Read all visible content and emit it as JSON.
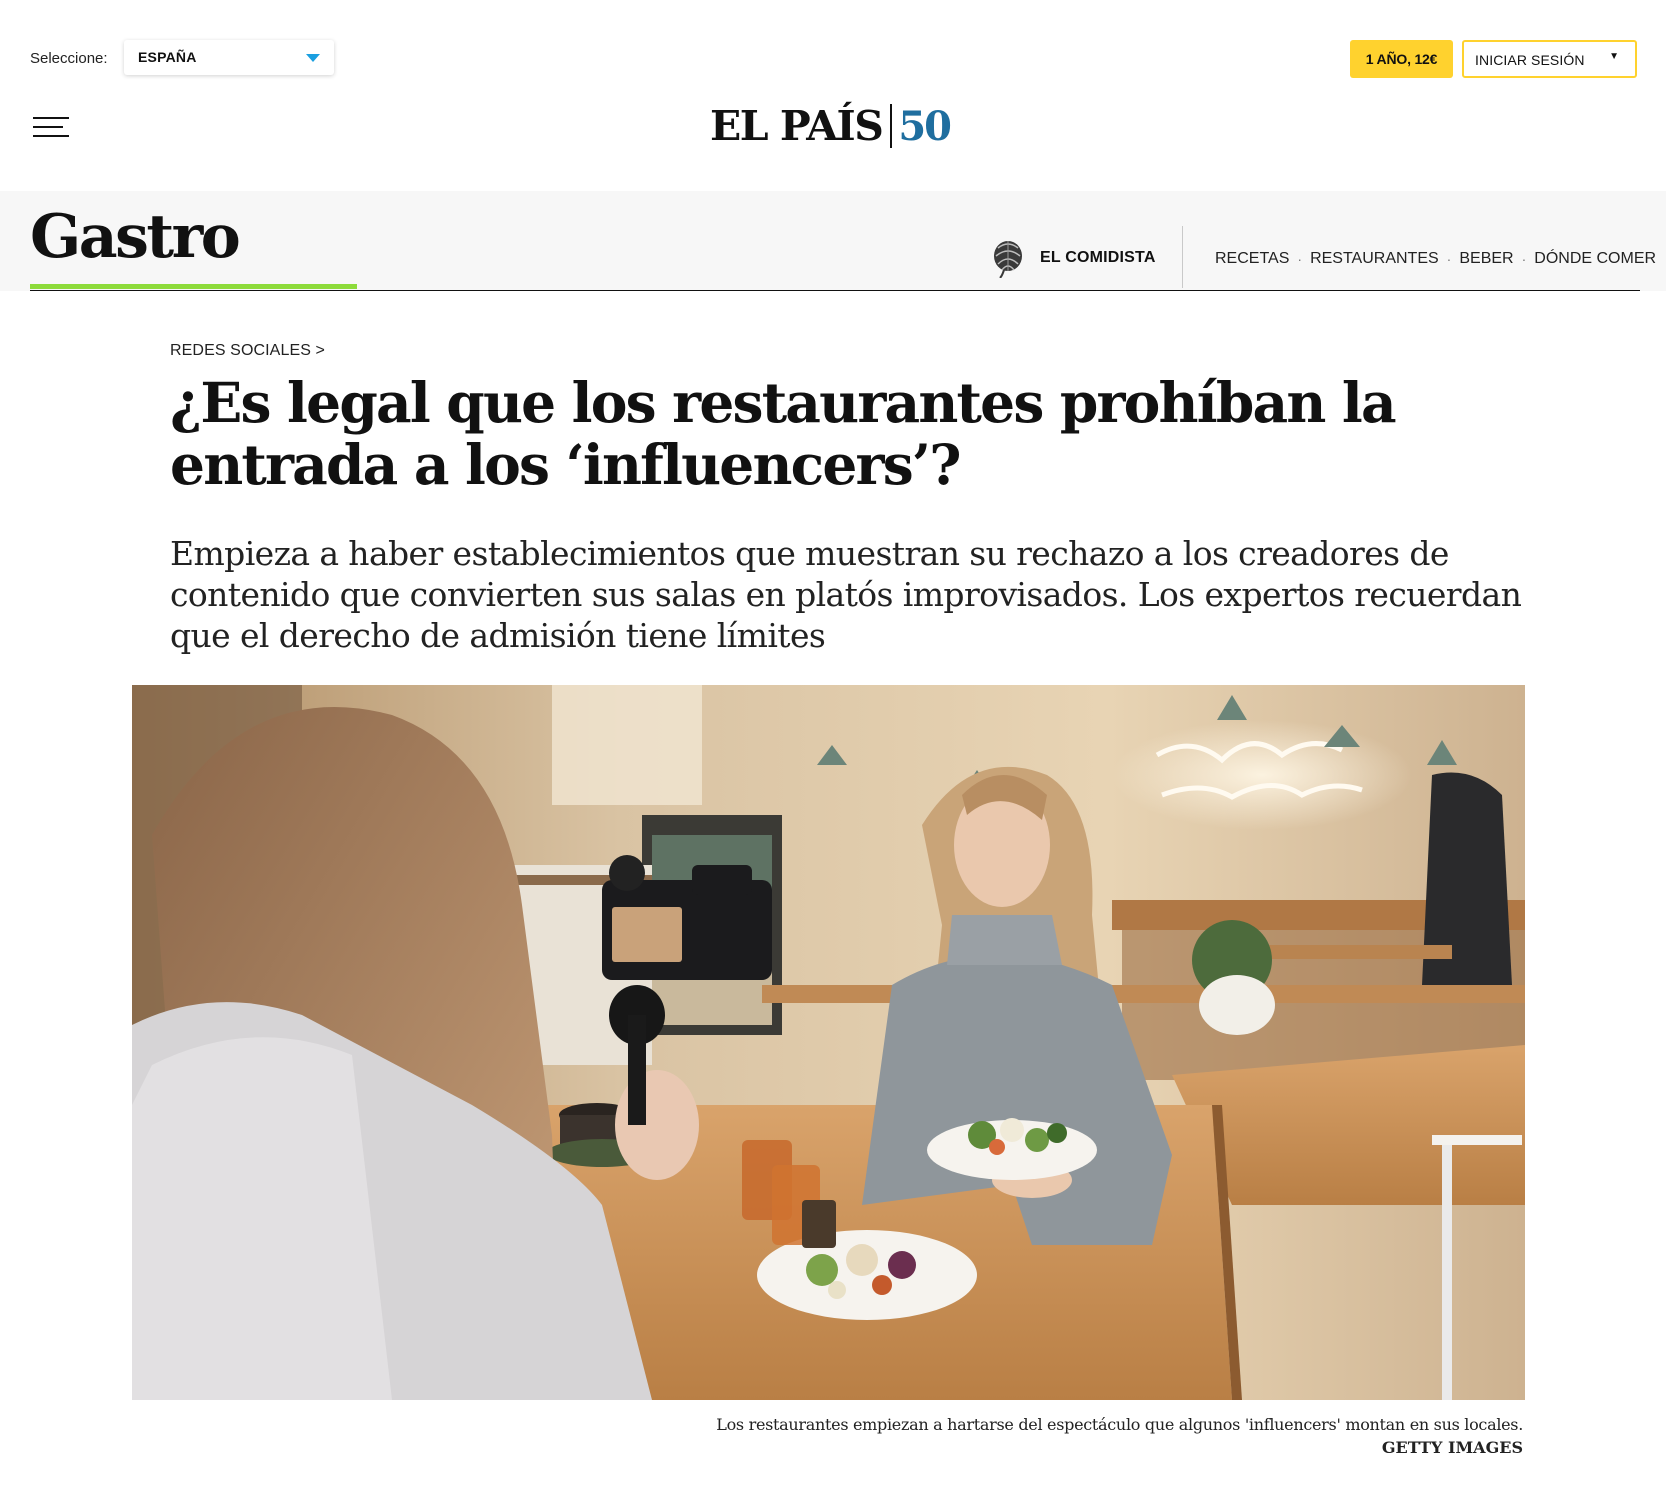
{
  "topbar": {
    "region_label": "Seleccione:",
    "region_value": "ESPAÑA",
    "subscribe_label": "1 AÑO, 12€",
    "login_label": "INICIAR SESIÓN",
    "login_arrow": "▼"
  },
  "masthead": {
    "logo_name": "EL PAÍS",
    "logo_anniversary": "50"
  },
  "section": {
    "title": "Gastro",
    "el_comidista": "EL COMIDISTA",
    "nav": [
      "RECETAS",
      "RESTAURANTES",
      "BEBER",
      "DÓNDE COMER"
    ],
    "nav_separator": "·"
  },
  "article": {
    "kicker": "REDES SOCIALES >",
    "headline": "¿Es legal que los restaurantes prohíban la entrada a los ‘influencers’?",
    "standfirst": "Empieza a haber establecimientos que muestran su rechazo a los creadores de contenido que convierten sus salas en platós improvisados. Los expertos recuerdan que el derecho de admisión tiene límites",
    "photo_caption": "Los restaurantes empiezan a hartarse del espectáculo que algunos 'influencers' montan en sus locales.",
    "photo_credit": "GETTY IMAGES"
  },
  "colors": {
    "accent_yellow": "#ffd22e",
    "section_green": "#8ddb3a",
    "logo_blue": "#1f6e9f",
    "select_caret": "#1a9fe0"
  },
  "icons": {
    "menu": "hamburger-menu-icon",
    "comidista": "artichoke-icon",
    "dropdown": "caret-down-icon"
  }
}
